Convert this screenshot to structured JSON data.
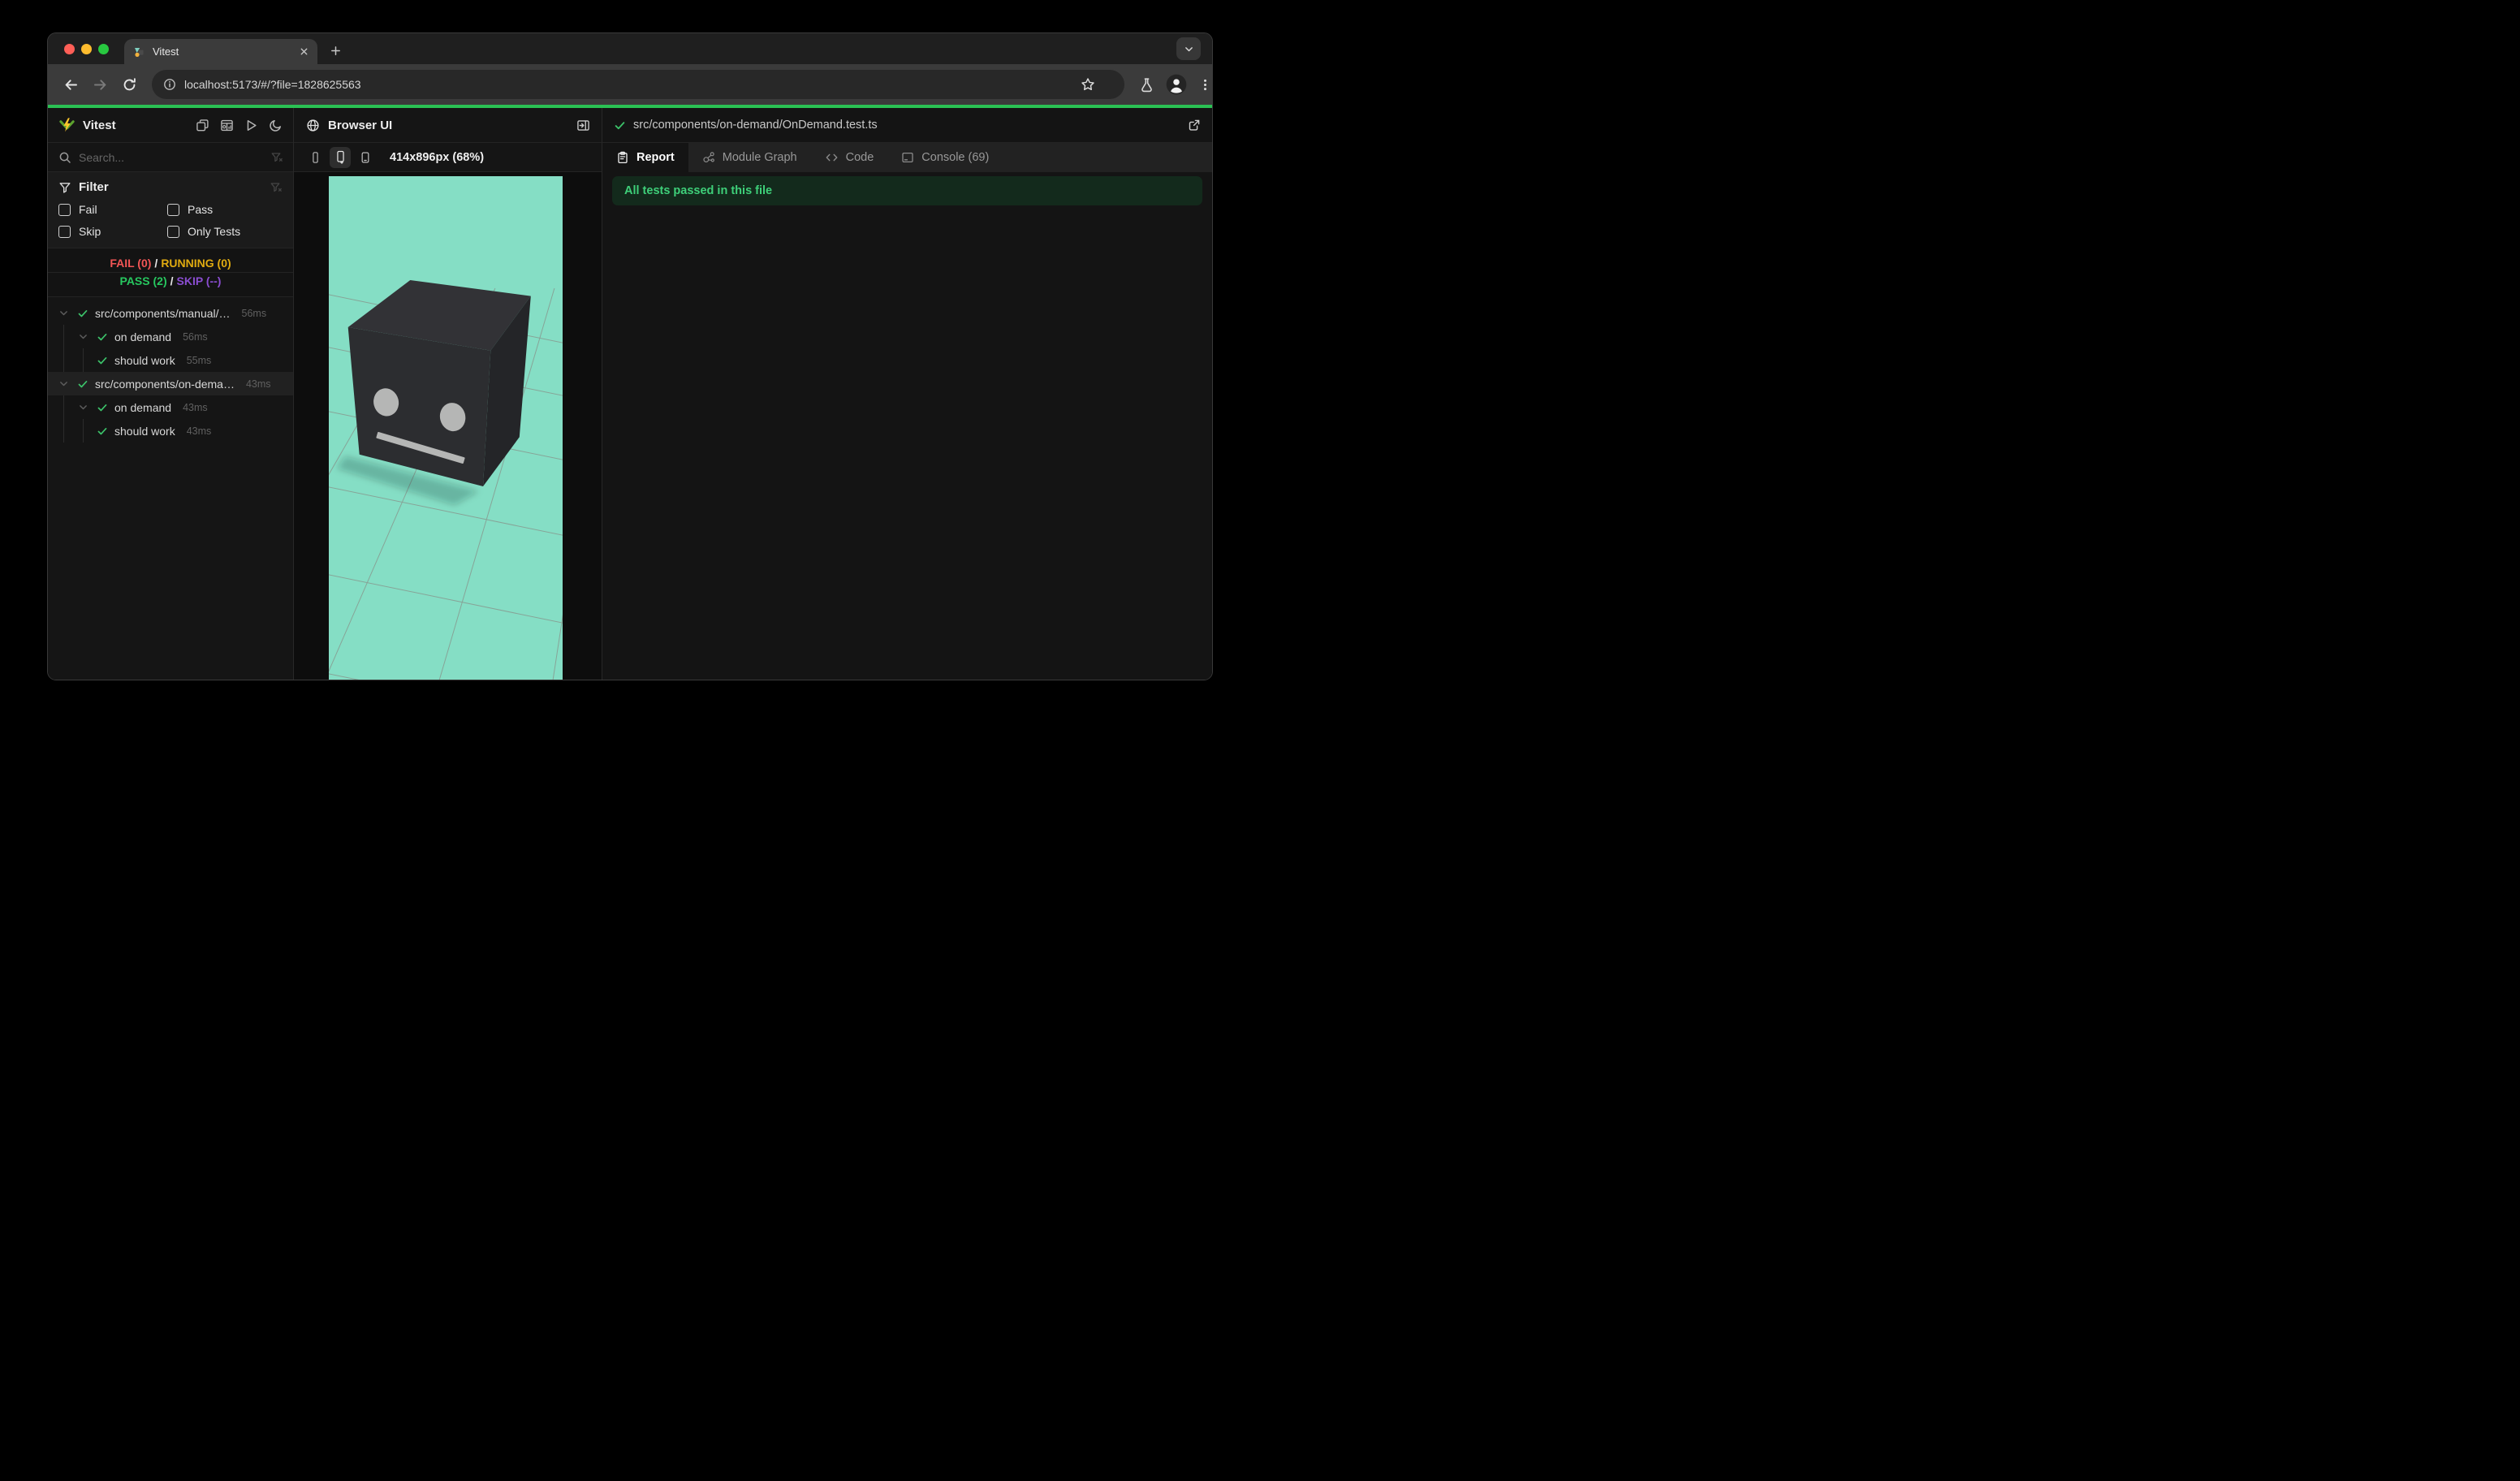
{
  "browser": {
    "tab_title": "Vitest",
    "url": "localhost:5173/#/?file=1828625563"
  },
  "sidebar": {
    "app_name": "Vitest",
    "search_placeholder": "Search...",
    "filter": {
      "title": "Filter",
      "options": [
        "Fail",
        "Pass",
        "Skip",
        "Only Tests"
      ]
    },
    "stats": {
      "fail": "FAIL (0)",
      "sep1": "/",
      "running": "RUNNING (0)",
      "pass": "PASS (2)",
      "sep2": "/",
      "skip": "SKIP (--)"
    },
    "tree": {
      "items": [
        {
          "label": "src/components/manual/…",
          "duration": "56ms"
        },
        {
          "label": "on demand",
          "duration": "56ms"
        },
        {
          "label": "should work",
          "duration": "55ms"
        },
        {
          "label": "src/components/on-dema…",
          "duration": "43ms"
        },
        {
          "label": "on demand",
          "duration": "43ms"
        },
        {
          "label": "should work",
          "duration": "43ms"
        }
      ]
    }
  },
  "browser_panel": {
    "title": "Browser UI",
    "viewport_label": "414x896px (68%)"
  },
  "report_panel": {
    "file_path": "src/components/on-demand/OnDemand.test.ts",
    "tabs": {
      "report": "Report",
      "module_graph": "Module Graph",
      "code": "Code",
      "console": "Console (69)"
    },
    "banner": "All tests passed in this file"
  },
  "colors": {
    "teal": "#85dec5",
    "progress": "#2bc154",
    "check": "#3cc36a",
    "fail": "#f25555",
    "running": "#e0ab10",
    "pass": "#27c75f",
    "skip": "#8a4dd0",
    "banner-bg": "#132a1c",
    "banner-text": "#3ecf79"
  }
}
